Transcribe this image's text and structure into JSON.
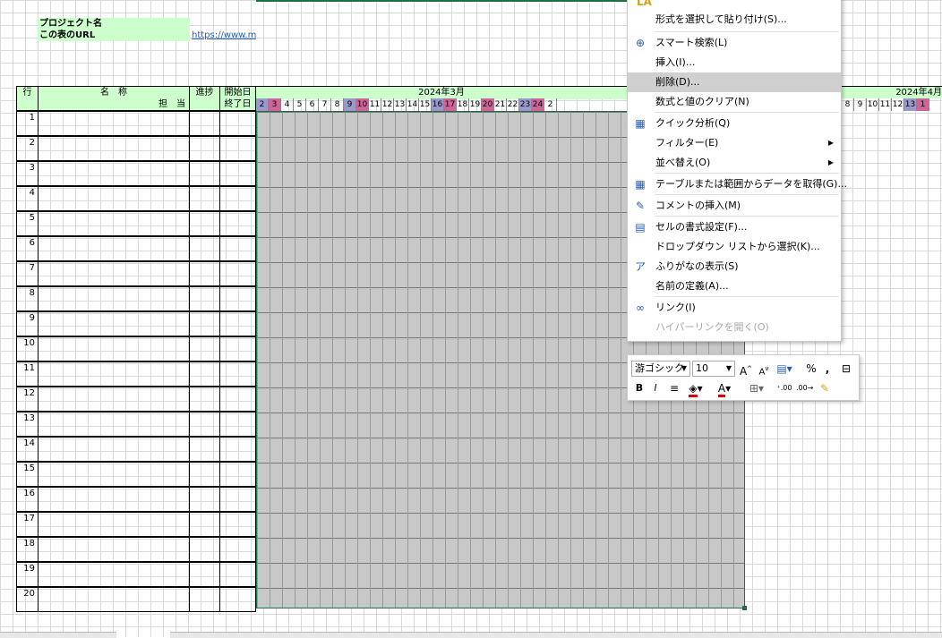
{
  "header": {
    "project_label": "プロジェクト名",
    "url_label": "この表のURL",
    "url_text": "https://www.m"
  },
  "table": {
    "col_row": "行",
    "col_name": "名　称",
    "col_person": "担　当",
    "col_progress": "進捗",
    "col_start": "開始日",
    "col_end": "終了日",
    "month_march": "2024年3月",
    "month_april": "2024年4月",
    "rows": [
      "1",
      "2",
      "3",
      "4",
      "5",
      "6",
      "7",
      "8",
      "9",
      "10",
      "11",
      "12",
      "13",
      "14",
      "15",
      "16",
      "17",
      "18",
      "19",
      "20"
    ]
  },
  "march_days": [
    {
      "d": "2",
      "c": "#9999cc"
    },
    {
      "d": "3",
      "c": "#cc6699"
    },
    {
      "d": "4",
      "c": ""
    },
    {
      "d": "5",
      "c": ""
    },
    {
      "d": "6",
      "c": ""
    },
    {
      "d": "7",
      "c": ""
    },
    {
      "d": "8",
      "c": ""
    },
    {
      "d": "9",
      "c": "#9999cc"
    },
    {
      "d": "10",
      "c": "#cc6699"
    },
    {
      "d": "11",
      "c": ""
    },
    {
      "d": "12",
      "c": ""
    },
    {
      "d": "13",
      "c": ""
    },
    {
      "d": "14",
      "c": ""
    },
    {
      "d": "15",
      "c": ""
    },
    {
      "d": "16",
      "c": "#9999cc"
    },
    {
      "d": "17",
      "c": "#cc6699"
    },
    {
      "d": "18",
      "c": ""
    },
    {
      "d": "19",
      "c": ""
    },
    {
      "d": "20",
      "c": "#cc6699"
    },
    {
      "d": "21",
      "c": ""
    },
    {
      "d": "22",
      "c": ""
    },
    {
      "d": "23",
      "c": "#9999cc"
    },
    {
      "d": "24",
      "c": "#cc6699"
    },
    {
      "d": "2",
      "c": ""
    }
  ],
  "april_days": [
    {
      "d": "8",
      "c": ""
    },
    {
      "d": "9",
      "c": ""
    },
    {
      "d": "10",
      "c": ""
    },
    {
      "d": "11",
      "c": ""
    },
    {
      "d": "12",
      "c": ""
    },
    {
      "d": "13",
      "c": "#9999cc"
    },
    {
      "d": "1",
      "c": "#cc6699"
    }
  ],
  "context_menu": {
    "top_item": "形式を選択して貼り付け(S)...",
    "items": [
      {
        "label": "スマート検索(L)",
        "icon": "smart-search-icon",
        "glyph": "⊕"
      },
      {
        "label": "挿入(I)...",
        "icon": "",
        "glyph": ""
      },
      {
        "label": "削除(D)...",
        "icon": "",
        "glyph": "",
        "highlight": true
      },
      {
        "label": "数式と値のクリア(N)",
        "icon": "",
        "glyph": ""
      },
      {
        "label": "クイック分析(Q)",
        "icon": "quick-analysis-icon",
        "glyph": "▦"
      },
      {
        "label": "フィルター(E)",
        "icon": "",
        "glyph": "",
        "submenu": true
      },
      {
        "label": "並べ替え(O)",
        "icon": "",
        "glyph": "",
        "submenu": true
      },
      {
        "label": "テーブルまたは範囲からデータを取得(G)...",
        "icon": "table-icon",
        "glyph": "▦"
      },
      {
        "label": "コメントの挿入(M)",
        "icon": "comment-icon",
        "glyph": "✎"
      },
      {
        "label": "セルの書式設定(F)...",
        "icon": "format-cells-icon",
        "glyph": "▤"
      },
      {
        "label": "ドロップダウン リストから選択(K)...",
        "icon": "",
        "glyph": ""
      },
      {
        "label": "ふりがなの表示(S)",
        "icon": "furigana-icon",
        "glyph": "ア"
      },
      {
        "label": "名前の定義(A)...",
        "icon": "",
        "glyph": ""
      },
      {
        "label": "リンク(I)",
        "icon": "link-icon",
        "glyph": "∞"
      },
      {
        "label": "ハイパーリンクを開く(O)",
        "icon": "",
        "glyph": "",
        "disabled": true
      }
    ]
  },
  "mini_toolbar": {
    "font": "游ゴシック",
    "size": "10"
  },
  "colors": {
    "header_green": "#ccffcc",
    "selection_gray": "#c8c8c8",
    "weekend_blue": "#9999cc",
    "holiday_pink": "#cc6699",
    "link": "#1f5fbf"
  }
}
